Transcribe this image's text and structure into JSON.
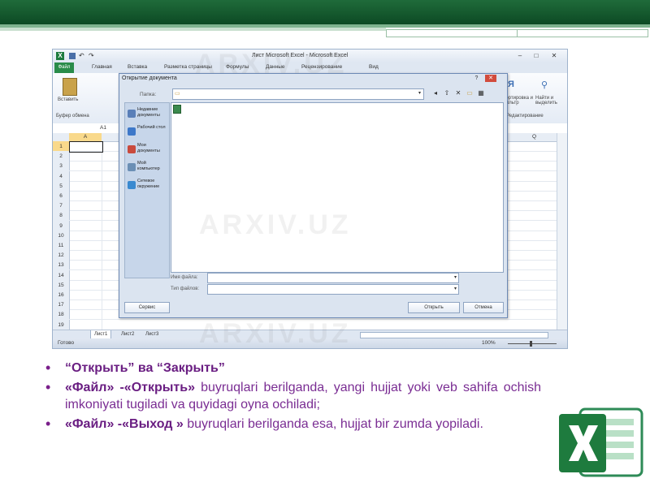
{
  "excel": {
    "title": "Лист Microsoft Excel  -  Microsoft Excel",
    "tabs": [
      "Файл",
      "Главная",
      "Вставка",
      "Разметка страницы",
      "Формулы",
      "Данные",
      "Рецензирование",
      "Вид"
    ],
    "ribbon": {
      "paste_label": "Вставить",
      "clipboard_group": "Буфер обмена",
      "sort_label": "Сортировка и фильтр",
      "find_label": "Найти и выделить",
      "edit_group": "Редактирование"
    },
    "name_box": "A1",
    "col_a": "A",
    "col_q": "Q",
    "rows": [
      "1",
      "2",
      "3",
      "4",
      "5",
      "6",
      "7",
      "8",
      "9",
      "10",
      "11",
      "12",
      "13",
      "14",
      "15",
      "16",
      "17",
      "18",
      "19"
    ],
    "sheets": [
      "Лист1",
      "Лист2",
      "Лист3"
    ],
    "status": "Готово",
    "zoom": "100%"
  },
  "dialog": {
    "title": "Открытие документа",
    "lookin_label": "Папка:",
    "places": [
      {
        "label": "Недавние документы",
        "icon": "recent-docs-icon",
        "color": "#5a7fb8"
      },
      {
        "label": "Рабочий стол",
        "icon": "desktop-icon",
        "color": "#3d78c9"
      },
      {
        "label": "Мои документы",
        "icon": "my-documents-icon",
        "color": "#c94a3d"
      },
      {
        "label": "Мой компьютер",
        "icon": "my-computer-icon",
        "color": "#6b8fb5"
      },
      {
        "label": "Сетевое окружение",
        "icon": "network-icon",
        "color": "#3a8ad0"
      }
    ],
    "filename_label": "Имя файла:",
    "filetype_label": "Тип файлов:",
    "service_label": "Сервис",
    "open_label": "Открыть",
    "cancel_label": "Отмена"
  },
  "bullets": [
    {
      "text": "“Открыть” ва “Закрыть”"
    },
    {
      "bold": "«Файл» -«Открыть»",
      "text": " buyruqlari berilganda, yangi hujjat yoki veb sahifa  ochish imkoniyati tugiladi va quyidagi oyna ochiladi;"
    },
    {
      "bold": "«Файл» -«Выход »",
      "text": " buyruqlari berilganda esa, hujjat bir zumda yopiladi."
    }
  ],
  "watermark": "ARXIV.UZ",
  "colors": {
    "banner": "#1f6b3a",
    "accent_purple": "#6a1e82",
    "excel_green": "#1e7b3e"
  }
}
